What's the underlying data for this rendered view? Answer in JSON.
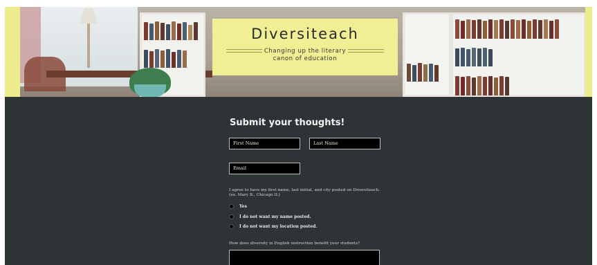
{
  "header": {
    "site_title": "Diversiteach",
    "tagline_line1": "Changing up the literary",
    "tagline_line2": "canon of education"
  },
  "form": {
    "heading": "Submit your thoughts!",
    "first_name_placeholder": "First Name",
    "last_name_placeholder": "Last Name",
    "email_placeholder": "Email",
    "consent_text": "I agree to have my first name, last initial, and city posted on Diversiteach. (ex. Mary B., Chicago IL)",
    "options": [
      {
        "label": "Yes"
      },
      {
        "label": "I do not want my name posted."
      },
      {
        "label": "I do not want my location posted."
      }
    ],
    "question": "How does diversity in English instruction benefit your students?"
  },
  "colors": {
    "accent_yellow": "#f0ef94",
    "page_background": "#2e3436",
    "field_background": "#000000"
  }
}
